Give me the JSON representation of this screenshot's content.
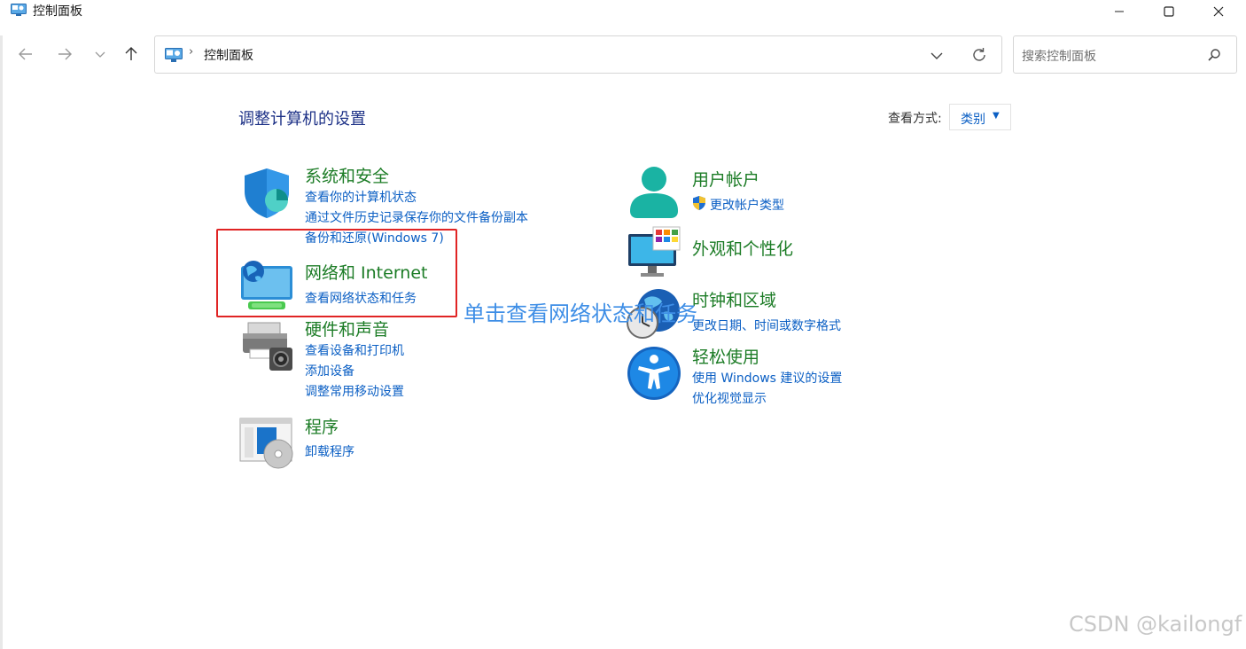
{
  "window": {
    "title": "控制面板"
  },
  "address": {
    "path": "控制面板",
    "separator": "›"
  },
  "search": {
    "placeholder": "搜索控制面板"
  },
  "main": {
    "heading": "调整计算机的设置",
    "view_by_label": "查看方式:",
    "view_by_value": "类别"
  },
  "categories": {
    "system": {
      "title": "系统和安全",
      "icon": "shield-icon",
      "links": [
        "查看你的计算机状态",
        "通过文件历史记录保存你的文件备份副本",
        "备份和还原(Windows 7)"
      ]
    },
    "network": {
      "title": "网络和 Internet",
      "icon": "network-globe-icon",
      "links": [
        "查看网络状态和任务"
      ]
    },
    "hardware": {
      "title": "硬件和声音",
      "icon": "printer-icon",
      "links": [
        "查看设备和打印机",
        "添加设备",
        "调整常用移动设置"
      ]
    },
    "programs": {
      "title": "程序",
      "icon": "programs-icon",
      "links": [
        "卸载程序"
      ]
    },
    "users": {
      "title": "用户帐户",
      "icon": "user-icon",
      "links": [
        "更改帐户类型"
      ]
    },
    "appearance": {
      "title": "外观和个性化",
      "icon": "monitor-icon",
      "links": []
    },
    "clock": {
      "title": "时钟和区域",
      "icon": "clock-globe-icon",
      "links": [
        "更改日期、时间或数字格式"
      ]
    },
    "ease": {
      "title": "轻松使用",
      "icon": "accessibility-icon",
      "links": [
        "使用 Windows 建议的设置",
        "优化视觉显示"
      ]
    }
  },
  "annotation": {
    "text": "单击查看网络状态和任务",
    "color": "#3e8ee6",
    "box_color": "#e02424"
  },
  "watermark": "CSDN @kailongf",
  "colors": {
    "heading": "#1e3287",
    "category_title": "#1c7c26",
    "link": "#0b5fc4"
  }
}
